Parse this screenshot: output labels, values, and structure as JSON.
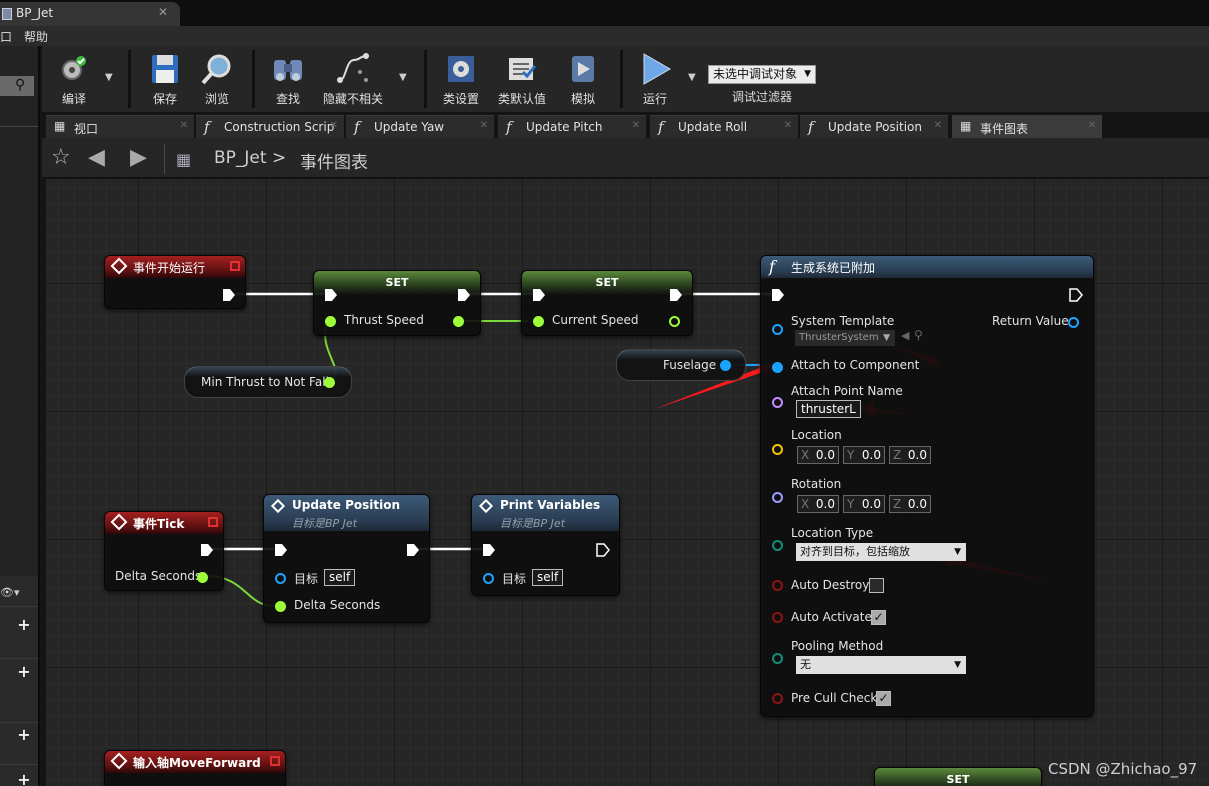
{
  "window": {
    "tab_title": "BP_Jet",
    "close": "✕"
  },
  "menu": {
    "partial": "口",
    "help": "帮助"
  },
  "toolbar": {
    "compile": "编译",
    "save": "保存",
    "browse": "浏览",
    "find": "查找",
    "hide_unrelated": "隐藏不相关",
    "class_settings": "类设置",
    "class_defaults": "类默认值",
    "simulate": "模拟",
    "run": "运行",
    "debug_object": "未选中调试对象",
    "debug_filter": "调试过滤器"
  },
  "tabs": [
    {
      "icon": "grid",
      "label": "视口"
    },
    {
      "icon": "f",
      "label": "Construction Scrip"
    },
    {
      "icon": "f",
      "label": "Update Yaw"
    },
    {
      "icon": "f",
      "label": "Update Pitch"
    },
    {
      "icon": "f",
      "label": "Update Roll"
    },
    {
      "icon": "f",
      "label": "Update Position"
    },
    {
      "icon": "grid",
      "label": "事件图表",
      "active": true
    }
  ],
  "breadcrumb": {
    "root": "BP_Jet",
    "separator": ">",
    "current": "事件图表"
  },
  "nodes": {
    "begin_play": {
      "title": "事件开始运行"
    },
    "set1": {
      "title": "SET",
      "var": "Thrust Speed"
    },
    "set2": {
      "title": "SET",
      "var": "Current Speed"
    },
    "min_thrust": {
      "label": "Min Thrust to Not Fall"
    },
    "fuselage": {
      "label": "Fuselage"
    },
    "spawn": {
      "title": "生成系统已附加",
      "system_template": "System Template",
      "system_template_value": "ThrusterSystem",
      "return_value": "Return Value",
      "attach_component": "Attach to Component",
      "attach_point": "Attach Point Name",
      "attach_point_value": "thrusterL",
      "location": "Location",
      "rotation": "Rotation",
      "axis_x": "X",
      "axis_y": "Y",
      "axis_z": "Z",
      "zero": "0.0",
      "location_type": "Location Type",
      "location_type_value": "对齐到目标，包括缩放",
      "auto_destroy": "Auto Destroy",
      "auto_activate": "Auto Activate",
      "pooling": "Pooling Method",
      "pooling_value": "无",
      "pre_cull": "Pre Cull Check",
      "checkmark": "✓"
    },
    "tick": {
      "title": "事件Tick",
      "delta": "Delta Seconds"
    },
    "update_position": {
      "title": "Update Position",
      "subtitle": "目标是BP Jet",
      "target": "目标",
      "self": "self",
      "delta": "Delta Seconds"
    },
    "print_vars": {
      "title": "Print Variables",
      "subtitle": "目标是BP Jet",
      "target": "目标",
      "self": "self"
    },
    "move_forward": {
      "title": "输入轴MoveForward"
    },
    "set3": {
      "title": "SET"
    }
  },
  "watermark": "CSDN @Zhichao_97",
  "colors": {
    "exec": "#ffffff",
    "float": "#9cff3a",
    "object": "#1aa3ff",
    "name": "#c58bff",
    "vector": "#f5c400",
    "rotator": "#9a9cff",
    "byte": "#0f8f7a",
    "bool": "#8c1414",
    "arrow": "#ff2020"
  }
}
